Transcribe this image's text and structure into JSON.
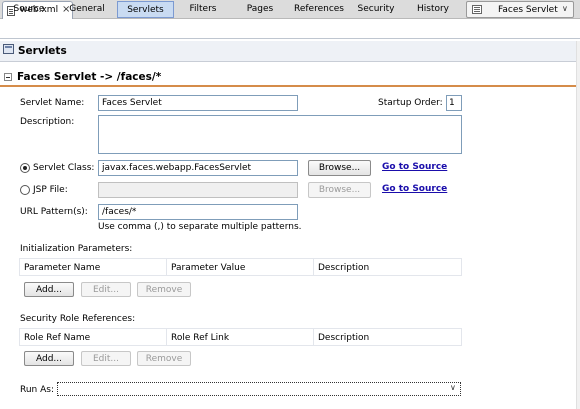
{
  "file_tab": {
    "name": "web.xml",
    "close": "×"
  },
  "view_tabs": [
    {
      "label": "Source"
    },
    {
      "label": "General"
    },
    {
      "label": "Servlets"
    },
    {
      "label": "Filters"
    },
    {
      "label": "Pages"
    },
    {
      "label": "References"
    },
    {
      "label": "Security"
    },
    {
      "label": "History"
    }
  ],
  "active_tab": "Servlets",
  "selector": {
    "value": "Faces Servlet",
    "arrow": "∨"
  },
  "section": {
    "title": "Servlets"
  },
  "servlet": {
    "header": "Faces Servlet -> /faces/*",
    "name_label": "Servlet Name:",
    "name_value": "Faces Servlet",
    "startup_label": "Startup Order:",
    "startup_value": "1",
    "description_label": "Description:",
    "description_value": "",
    "class_label": "Servlet Class:",
    "class_value": "javax.faces.webapp.FacesServlet",
    "class_selected": true,
    "jsp_label": "JSP File:",
    "jsp_value": "",
    "browse_label": "Browse...",
    "browse_disabled_label": "Browse...",
    "goto_source_label": "Go to Source",
    "goto_source_label_2": "Go to Source",
    "url_label": "URL Pattern(s):",
    "url_value": "/faces/*",
    "url_hint": "Use comma (,) to separate multiple patterns."
  },
  "init_params": {
    "title": "Initialization Parameters:",
    "columns": [
      "Parameter Name",
      "Parameter Value",
      "Description"
    ],
    "add": "Add...",
    "edit": "Edit...",
    "remove": "Remove"
  },
  "role_refs": {
    "title": "Security Role References:",
    "columns": [
      "Role Ref Name",
      "Role Ref Link",
      "Description"
    ],
    "add": "Add...",
    "edit": "Edit...",
    "remove": "Remove"
  },
  "run_as": {
    "label": "Run As:",
    "value": "",
    "arrow": "∨"
  },
  "colors": {
    "accent_line": "#d58c4a",
    "active_tab_bg": "#c9dbf2",
    "link": "#1a0dab"
  }
}
